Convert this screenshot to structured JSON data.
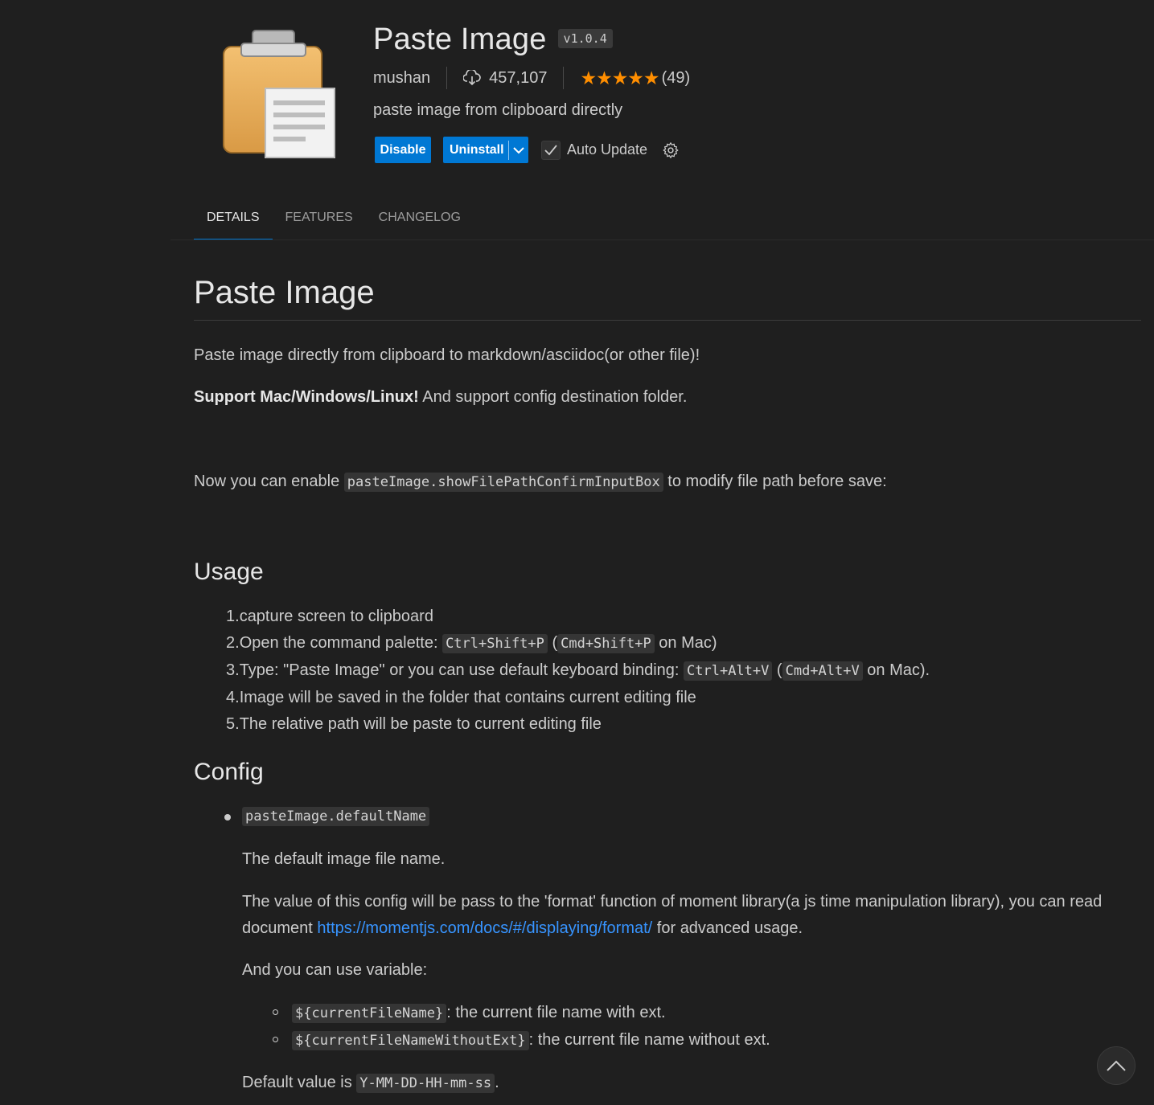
{
  "extension": {
    "title": "Paste Image",
    "version": "v1.0.4",
    "publisher": "mushan",
    "install_count": "457,107",
    "rating_stars": "★★★★★",
    "rating_count": "(49)",
    "description": "paste image from clipboard directly",
    "buttons": {
      "disable": "Disable",
      "uninstall": "Uninstall",
      "auto_update": "Auto Update"
    }
  },
  "tabs": [
    "DETAILS",
    "FEATURES",
    "CHANGELOG"
  ],
  "readme": {
    "h1": "Paste Image",
    "p1": "Paste image directly from clipboard to markdown/asciidoc(or other file)!",
    "p2_bold": "Support Mac/Windows/Linux!",
    "p2_rest": " And support config destination folder.",
    "p3_pre": "Now you can enable ",
    "p3_code": "pasteImage.showFilePathConfirmInputBox",
    "p3_post": " to modify file path before save:",
    "usage_heading": "Usage",
    "usage": {
      "i1": "capture screen to clipboard",
      "i2_pre": "Open the command palette: ",
      "i2_code1": "Ctrl+Shift+P",
      "i2_mid": " (",
      "i2_code2": "Cmd+Shift+P",
      "i2_post": " on Mac)",
      "i3_pre": "Type: \"Paste Image\" or you can use default keyboard binding: ",
      "i3_code1": "Ctrl+Alt+V",
      "i3_mid": " (",
      "i3_code2": "Cmd+Alt+V",
      "i3_post": " on Mac).",
      "i4": "Image will be saved in the folder that contains current editing file",
      "i5": "The relative path will be paste to current editing file"
    },
    "config_heading": "Config",
    "config": {
      "key": "pasteImage.defaultName",
      "desc1": "The default image file name.",
      "desc2_a": "The value of this config will be pass to the 'format' function of moment library(a js time manipulation library), you can read",
      "desc2_b_pre": "document ",
      "desc2_link": "https://momentjs.com/docs/#/displaying/format/",
      "desc2_b_post": " for advanced usage.",
      "desc3": "And you can use variable:",
      "var1_code": "${currentFileName}",
      "var1_text": ": the current file name with ext.",
      "var2_code": "${currentFileNameWithoutExt}",
      "var2_text": ": the current file name without ext.",
      "default_pre": "Default value is ",
      "default_code": "Y-MM-DD-HH-mm-ss",
      "default_post": "."
    }
  },
  "colors": {
    "accent": "#0078d4",
    "star": "#ff8e00",
    "link": "#3794ff",
    "background": "#1f1f1f"
  }
}
